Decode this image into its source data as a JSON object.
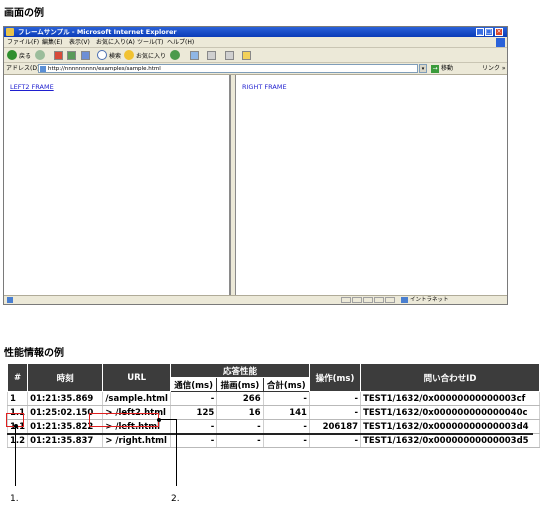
{
  "headings": {
    "screen_example": "画面の例",
    "performance_example": "性能情報の例"
  },
  "browser": {
    "window_title": "フレームサンプル - Microsoft Internet Explorer",
    "window_controls": [
      "_",
      "□",
      "×"
    ],
    "menu": [
      "ファイル(F)",
      "編集(E)",
      "表示(V)",
      "お気に入り(A)",
      "ツール(T)",
      "ヘルプ(H)"
    ],
    "toolbar": {
      "back_label": "戻る",
      "search_label": "検索",
      "favorites_label": "お気に入り"
    },
    "address": {
      "label": "アドレス(D)",
      "value": "http://nnnnnnnnn/examples/sample.html",
      "go_label": "移動",
      "links_label": "リンク »"
    },
    "left_frame": {
      "link_text": "LEFT2 FRAME"
    },
    "right_frame": {
      "text": "RIGHT FRAME"
    },
    "status": {
      "zone_label": "イントラネット"
    },
    "colors": {
      "titlebar": "#0a3bb7",
      "frame_text": "#1f1fcf"
    }
  },
  "table": {
    "headers": {
      "num": "#",
      "time": "時刻",
      "url": "URL",
      "response": "応答性能",
      "communication": "通信(ms)",
      "render": "描画(ms)",
      "total": "合計(ms)",
      "operation": "操作(ms)",
      "inquiry_id": "問い合わせID"
    },
    "rows": [
      {
        "num": "1",
        "time": "01:21:35.869",
        "url": "/sample.html",
        "comm": "-",
        "render": "266",
        "total": "-",
        "op": "-",
        "id": "TEST1/1632/0x00000000000003cf"
      },
      {
        "num": "1.1",
        "time": "01:25:02.150",
        "url": "> /left2.html",
        "comm": "125",
        "render": "16",
        "total": "141",
        "op": "-",
        "id": "TEST1/1632/0x000000000000040c"
      },
      {
        "num": "1.1",
        "time": "01:21:35.822",
        "url": "> /left.html",
        "comm": "-",
        "render": "-",
        "total": "-",
        "op": "206187",
        "id": "TEST1/1632/0x00000000000003d4"
      },
      {
        "num": "1.2",
        "time": "01:21:35.837",
        "url": "> /right.html",
        "comm": "-",
        "render": "-",
        "total": "-",
        "op": "-",
        "id": "TEST1/1632/0x00000000000003d5"
      }
    ],
    "highlight_color": "#e02020"
  },
  "callouts": {
    "one": "1.",
    "two": "2."
  }
}
